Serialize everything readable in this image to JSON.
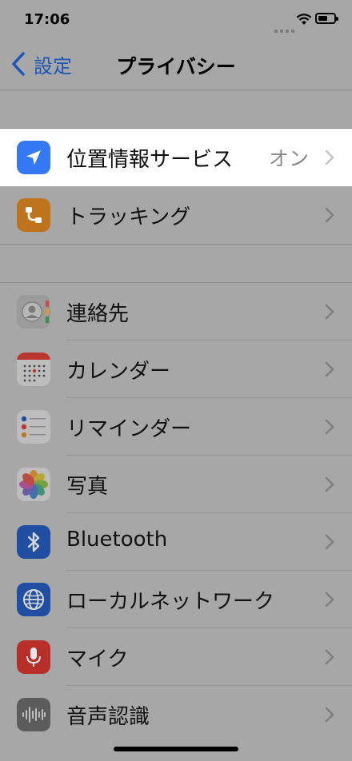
{
  "status_bar": {
    "time": "17:06"
  },
  "nav": {
    "back_label": "設定",
    "title": "プライバシー"
  },
  "group1": [
    {
      "label": "位置情報サービス",
      "value": "オン",
      "icon": "location-arrow-icon",
      "color": "#3478f6"
    },
    {
      "label": "トラッキング",
      "icon": "tracking-icon",
      "color": "#c0731d"
    }
  ],
  "group2": [
    {
      "label": "連絡先",
      "icon": "contacts-icon",
      "color": "#8f8f8f"
    },
    {
      "label": "カレンダー",
      "icon": "calendar-icon",
      "color": "#bdbdbd"
    },
    {
      "label": "リマインダー",
      "icon": "reminders-icon",
      "color": "#bdbdbd"
    },
    {
      "label": "写真",
      "icon": "photos-icon",
      "color": "#bdbdbd"
    },
    {
      "label": "Bluetooth",
      "icon": "bluetooth-icon",
      "color": "#1f4ea3"
    },
    {
      "label": "ローカルネットワーク",
      "icon": "globe-icon",
      "color": "#1f4ea3"
    },
    {
      "label": "マイク",
      "icon": "microphone-icon",
      "color": "#b82f2a"
    },
    {
      "label": "音声認識",
      "icon": "waveform-icon",
      "color": "#5c5c5c"
    }
  ]
}
